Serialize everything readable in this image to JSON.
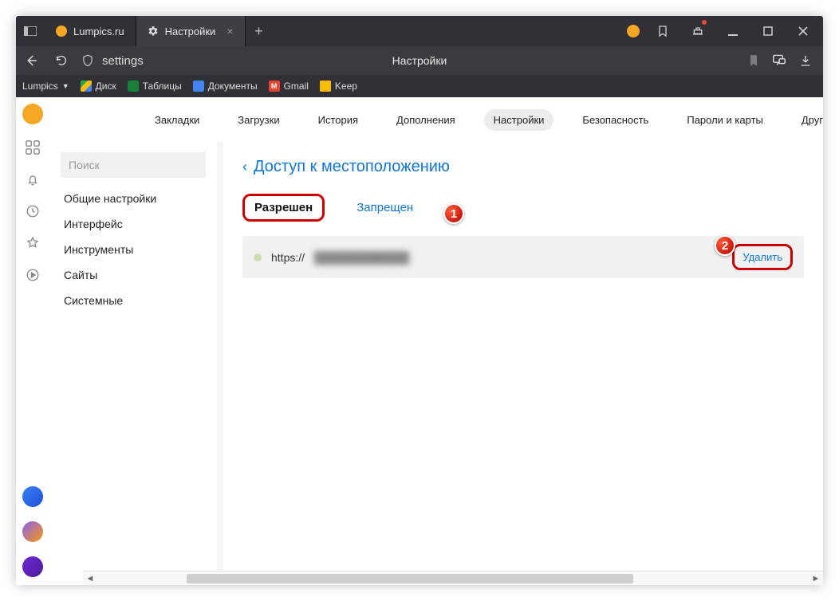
{
  "tabs": [
    {
      "label": "Lumpics.ru"
    },
    {
      "label": "Настройки"
    }
  ],
  "address": {
    "text": "settings",
    "title": "Настройки"
  },
  "bookmarks_bar": {
    "site": "Lumpics",
    "items": [
      {
        "label": "Диск"
      },
      {
        "label": "Таблицы"
      },
      {
        "label": "Документы"
      },
      {
        "label": "Gmail"
      },
      {
        "label": "Keep"
      }
    ]
  },
  "topnav": {
    "items": [
      "Закладки",
      "Загрузки",
      "История",
      "Дополнения",
      "Настройки",
      "Безопасность",
      "Пароли и карты",
      "Другие устройства"
    ],
    "active_index": 4
  },
  "sidebar": {
    "search_placeholder": "Поиск",
    "items": [
      "Общие настройки",
      "Интерфейс",
      "Инструменты",
      "Сайты",
      "Системные"
    ]
  },
  "panel": {
    "breadcrumb": "Доступ к местоположению",
    "subtabs": {
      "allowed": "Разрешен",
      "denied": "Запрещен"
    },
    "site": {
      "scheme": "https://",
      "rest": "████████████"
    },
    "delete_label": "Удалить"
  },
  "badges": {
    "one": "1",
    "two": "2"
  }
}
